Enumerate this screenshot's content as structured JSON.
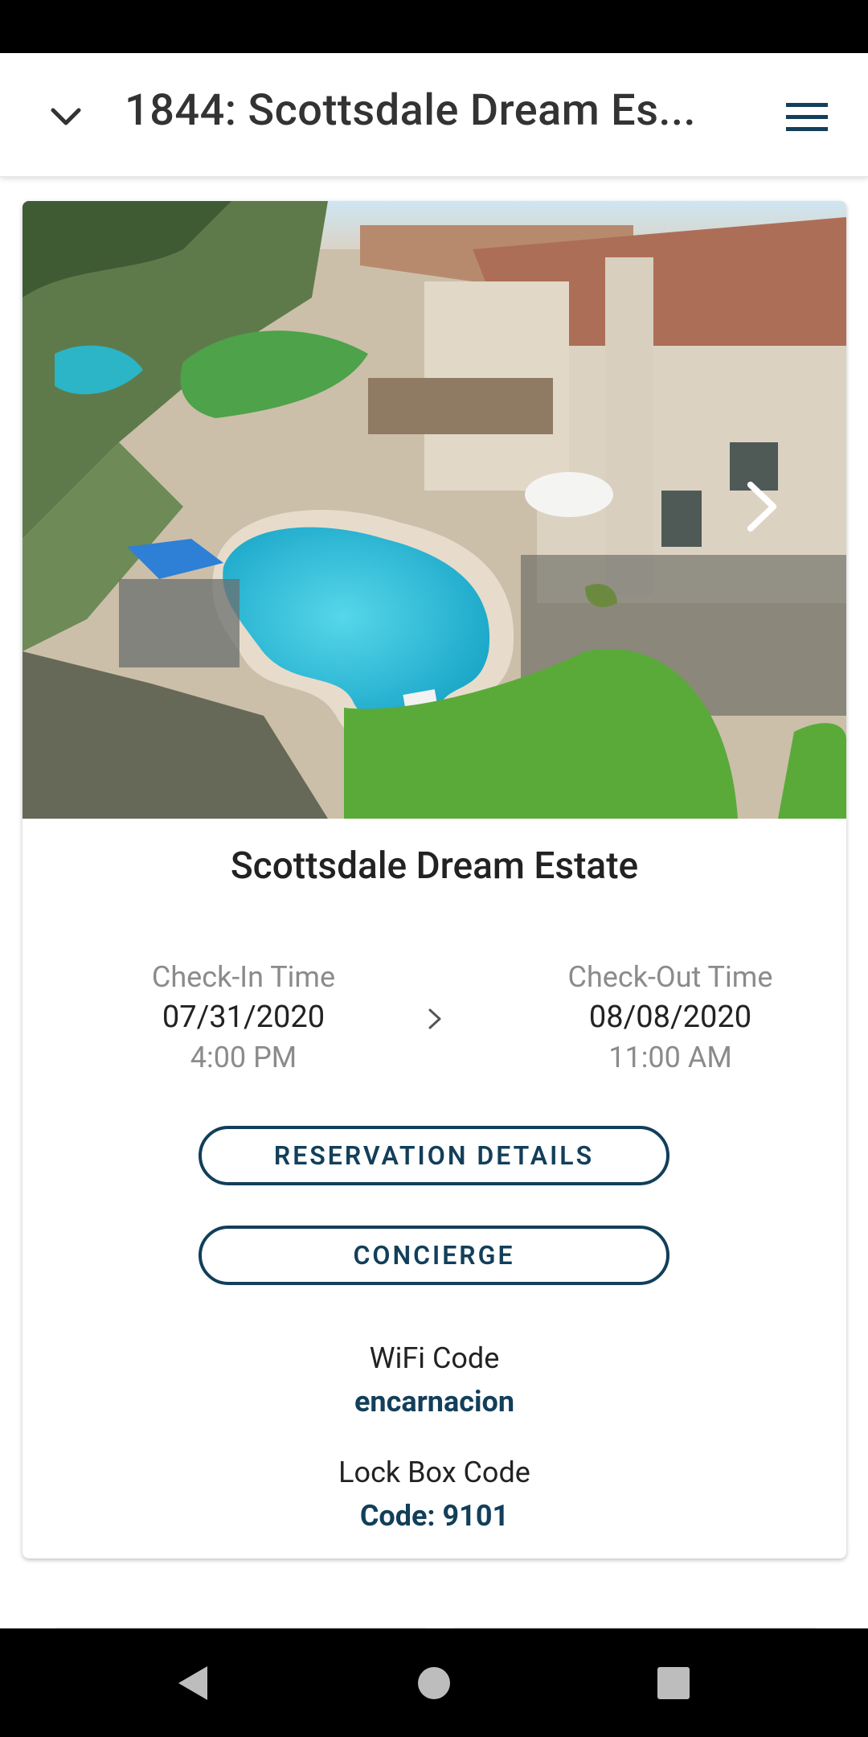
{
  "header": {
    "title": "1844: Scottsdale Dream Es...",
    "collapse_icon": "chevron-down-icon",
    "menu_icon": "hamburger-menu-icon"
  },
  "property": {
    "name": "Scottsdale Dream Estate",
    "photo": "aerial-pool-house-photo"
  },
  "check_in": {
    "label": "Check-In Time",
    "date": "07/31/2020",
    "time": "4:00 PM"
  },
  "check_out": {
    "label": "Check-Out Time",
    "date": "08/08/2020",
    "time": "11:00 AM"
  },
  "buttons": {
    "reservation_details": "RESERVATION DETAILS",
    "concierge": "CONCIERGE"
  },
  "wifi": {
    "label": "WiFi Code",
    "value": "encarnacion"
  },
  "lockbox": {
    "label": "Lock Box Code",
    "value": "Code: 9101"
  },
  "colors": {
    "accent": "#123f5a",
    "muted_text": "#8b8b8b"
  }
}
